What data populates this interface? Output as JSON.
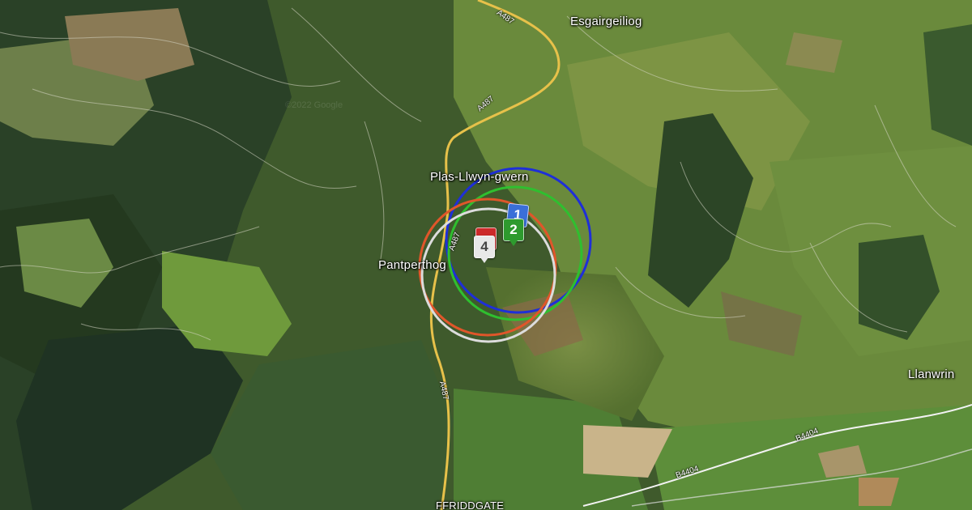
{
  "map": {
    "places": [
      {
        "id": "esgairgeiliog",
        "name": "Esgairgeiliog"
      },
      {
        "id": "plas-llwyn-gwern",
        "name": "Plas-Llwyn-gwern"
      },
      {
        "id": "pantperthog",
        "name": "Pantperthog"
      },
      {
        "id": "llanwrin",
        "name": "Llanwrin"
      },
      {
        "id": "ffriddgate",
        "name": "FFRIDDGATE"
      }
    ],
    "roads": [
      {
        "id": "a487-north",
        "label": "A487"
      },
      {
        "id": "a487-mid",
        "label": "A487"
      },
      {
        "id": "a487-circle",
        "label": "A487"
      },
      {
        "id": "a487-south",
        "label": "A487"
      },
      {
        "id": "b4404-east",
        "label": "B4404"
      },
      {
        "id": "b4404-south",
        "label": "B4404"
      }
    ],
    "markers": [
      {
        "id": "1",
        "label": "1",
        "color": "#3a6fd8"
      },
      {
        "id": "2",
        "label": "2",
        "color": "#2e9a2e"
      },
      {
        "id": "3",
        "label": "",
        "color": "#cc2a2a"
      },
      {
        "id": "4",
        "label": "4",
        "color": "#e8e8e8"
      }
    ],
    "rings": [
      {
        "id": "blue",
        "color": "#1e2fd8"
      },
      {
        "id": "green",
        "color": "#2fbf2f"
      },
      {
        "id": "orange",
        "color": "#e0562a"
      },
      {
        "id": "white",
        "color": "#dcdcdc"
      }
    ],
    "watermark": "©2022 Google"
  }
}
